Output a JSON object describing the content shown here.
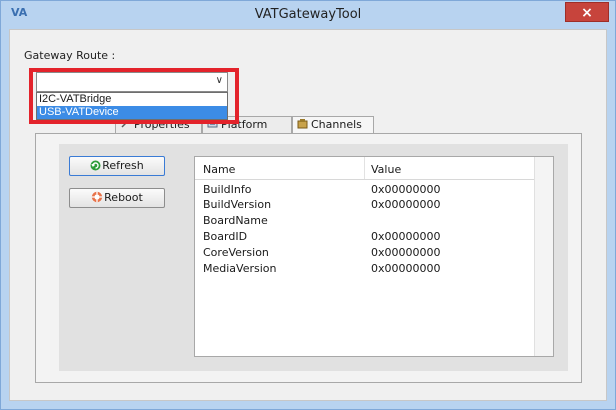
{
  "window": {
    "title": "VATGatewayTool",
    "app_icon": "VA",
    "close_glyph": "×"
  },
  "gateway": {
    "label": "Gateway Route :",
    "selected_value": "",
    "options": [
      "I2C-VATBridge",
      "USB-VATDevice"
    ],
    "highlighted_option": "USB-VATDevice"
  },
  "tabs": [
    {
      "label": "Properties",
      "icon": "properties-icon"
    },
    {
      "label": "Platform",
      "icon": "platform-icon"
    },
    {
      "label": "Channels",
      "icon": "channels-icon"
    }
  ],
  "buttons": {
    "refresh": "Refresh",
    "reboot": "Reboot"
  },
  "table": {
    "columns": [
      "Name",
      "Value"
    ],
    "rows": [
      [
        "BuildInfo",
        "0x00000000"
      ],
      [
        "BuildVersion",
        "0x00000000"
      ],
      [
        "BoardName",
        ""
      ],
      [
        "BoardID",
        "0x00000000"
      ],
      [
        "CoreVersion",
        "0x00000000"
      ],
      [
        "MediaVersion",
        "0x00000000"
      ]
    ]
  },
  "colors": {
    "highlight_box": "#e3232b",
    "selected_option": "#3c8ce6",
    "close_button": "#c7443c",
    "title_bar": "#b8d3f0"
  }
}
